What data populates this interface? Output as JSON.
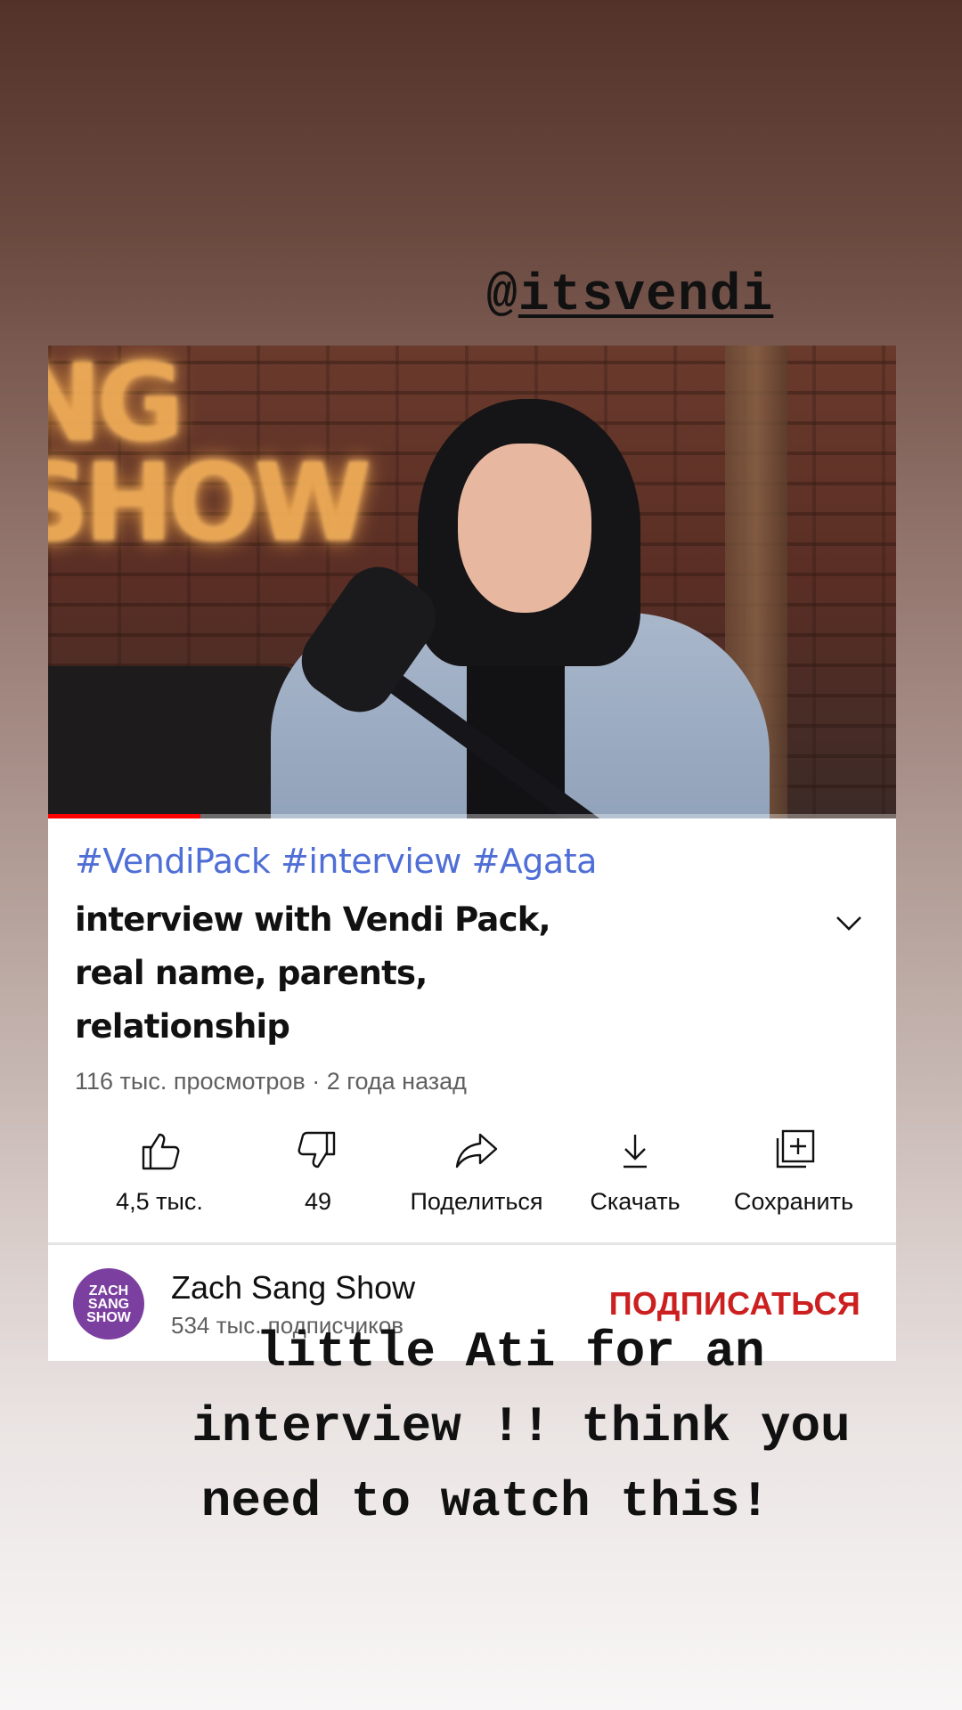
{
  "story": {
    "mention_at": "@",
    "mention_handle": "itsvendi",
    "caption": [
      "little Ati for an",
      "interview !! think you",
      "need to watch this!"
    ]
  },
  "video": {
    "progress": 0.18,
    "hashtags": "#VendiPack #interview #Agata",
    "title": "interview with Vendi Pack, real name, parents, relationship",
    "meta": "116 тыс. просмотров · 2 года назад",
    "thumbnail_sign_text": "NG SHOW",
    "actions": {
      "like": "4,5 тыс.",
      "dislike": "49",
      "share": "Поделиться",
      "download": "Скачать",
      "save": "Сохранить"
    }
  },
  "channel": {
    "avatar_text": "ZACH SANG SHOW",
    "name": "Zach Sang Show",
    "subscribers": "534 тыс. подписчиков",
    "subscribe_label": "ПОДПИСАТЬСЯ"
  },
  "colors": {
    "hashtag": "#4f6ed6",
    "subscribe": "#cc1f1f",
    "avatar": "#7b3fa0"
  }
}
